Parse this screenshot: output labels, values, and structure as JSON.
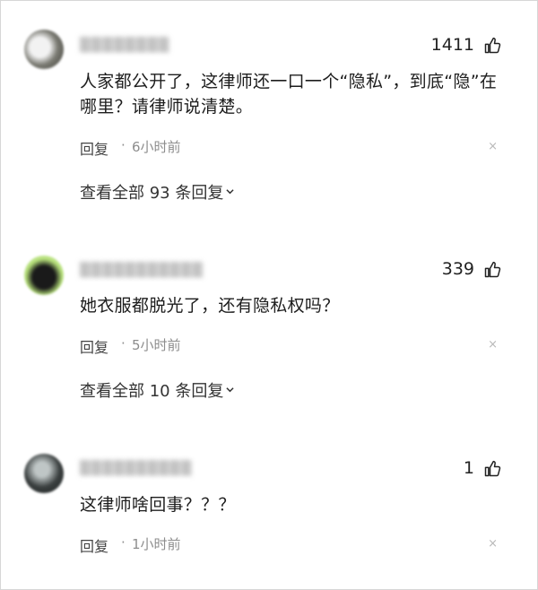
{
  "comments": [
    {
      "username": "▒▒▒▒▒▒▒▒",
      "likes": "1411",
      "text": "人家都公开了，这律师还一口一个“隐私”，到底“隐”在哪里？请律师说清楚。",
      "reply_label": "回复",
      "dot": "·",
      "time": "6小时前",
      "close": "×",
      "view_all": "查看全部 93 条回复",
      "like_icon": "thumbs-up-icon"
    },
    {
      "username": "▒▒▒▒▒▒▒▒▒▒▒",
      "likes": "339",
      "text": "她衣服都脱光了，还有隐私权吗？",
      "reply_label": "回复",
      "dot": "·",
      "time": "5小时前",
      "close": "×",
      "view_all": "查看全部 10 条回复",
      "like_icon": "thumbs-up-icon"
    },
    {
      "username": "▒▒▒▒▒▒▒▒▒▒",
      "likes": "1",
      "text": "这律师啥回事？？？",
      "reply_label": "回复",
      "dot": "·",
      "time": "1小时前",
      "close": "×",
      "like_icon": "thumbs-up-icon"
    }
  ],
  "colors": {
    "text": "#1d1d1d",
    "muted": "#8d8d8d",
    "border": "#d6d6d6"
  }
}
